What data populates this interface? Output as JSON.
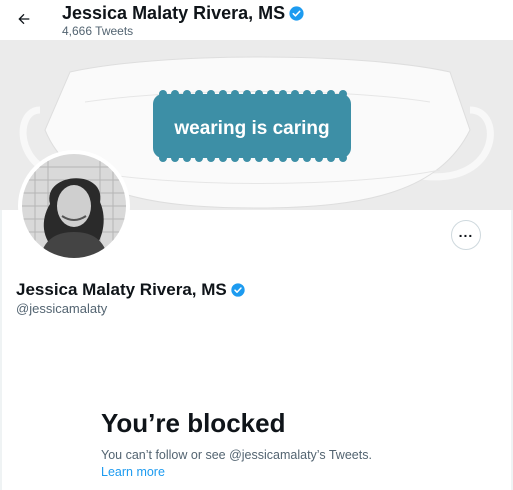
{
  "header": {
    "name": "Jessica Malaty Rivera, MS",
    "tweet_count": "4,666 Tweets"
  },
  "banner": {
    "mask_text": "wearing is caring"
  },
  "profile": {
    "name": "Jessica Malaty Rivera, MS",
    "handle": "@jessicamalaty"
  },
  "blocked": {
    "title": "You’re blocked",
    "description": "You can’t follow or see @jessicamalaty’s Tweets.",
    "link": "Learn more"
  },
  "icons": {
    "back": "arrow-left-icon",
    "verified": "verified-badge-icon",
    "more": "more-horizontal-icon"
  },
  "colors": {
    "verified": "#1d9bf0",
    "mask_label": "#3d8fa6",
    "link": "#1d9bf0"
  }
}
